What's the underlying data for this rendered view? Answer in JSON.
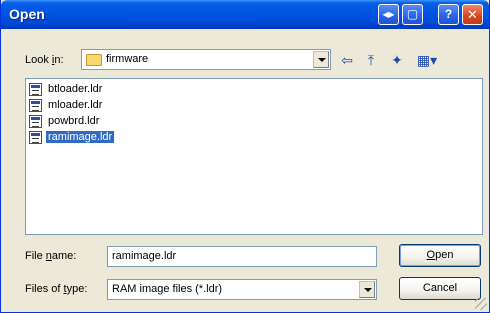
{
  "window": {
    "title": "Open"
  },
  "titlebar_buttons": {
    "ctx1": "◂▸",
    "ctx2": "▢",
    "help": "?",
    "close": "✕"
  },
  "look_in": {
    "label_pre": "Look ",
    "label_ul": "i",
    "label_post": "n:",
    "value": "firmware"
  },
  "toolbar": {
    "back": "⇦",
    "up": "⤒",
    "new_folder": "✦",
    "views": "▦▾"
  },
  "files": [
    {
      "name": "btloader.ldr",
      "selected": false
    },
    {
      "name": "mloader.ldr",
      "selected": false
    },
    {
      "name": "powbrd.ldr",
      "selected": false
    },
    {
      "name": "ramimage.ldr",
      "selected": true
    }
  ],
  "file_name": {
    "label_pre": "File ",
    "label_ul": "n",
    "label_post": "ame:",
    "value": "ramimage.ldr"
  },
  "file_type": {
    "label_pre": "Files of ",
    "label_ul": "t",
    "label_post": "ype:",
    "value": "RAM image files (*.ldr)"
  },
  "buttons": {
    "open_ul": "O",
    "open_rest": "pen",
    "cancel": "Cancel"
  },
  "colors": {
    "titlebar": "#0054e3",
    "face": "#ece9d8",
    "selection": "#316ac5"
  }
}
